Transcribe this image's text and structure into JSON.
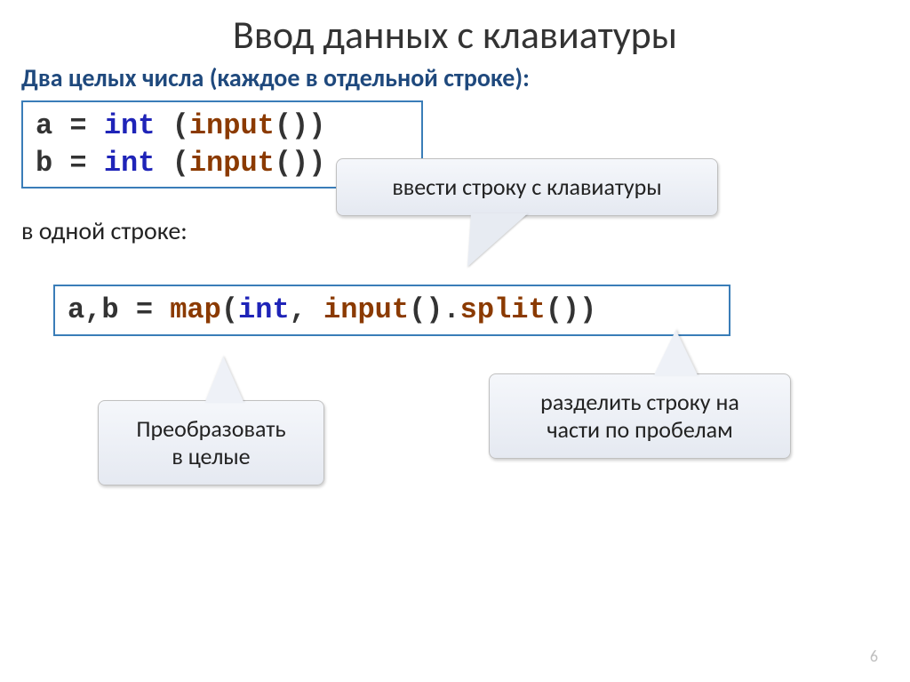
{
  "title": "Ввод данных с клавиатуры",
  "subtitle": "Два целых числа (каждое в отдельной строке):",
  "code1": {
    "line1": {
      "a": "a = ",
      "int_kw": "int",
      "paren_open": " (",
      "input_kw": "input",
      "paren_close": "())"
    },
    "line2": {
      "a": "b = ",
      "int_kw": "int",
      "paren_open": " (",
      "input_kw": "input",
      "paren_close": "())"
    }
  },
  "inline_text": "в одной строке:",
  "code2": {
    "ab_eq": "a,b = ",
    "map_kw": "map",
    "open1": "(",
    "int_kw": "int",
    "comma_sp": ", ",
    "input_kw": "input",
    "dot_open": "().",
    "split_kw": "split",
    "close": "())"
  },
  "callouts": {
    "input": "ввести строку с клавиатуры",
    "convert_line1": "Преобразовать",
    "convert_line2": "в целые",
    "split_line1": "разделить строку на",
    "split_line2": "части по пробелам"
  },
  "page_number": "6"
}
